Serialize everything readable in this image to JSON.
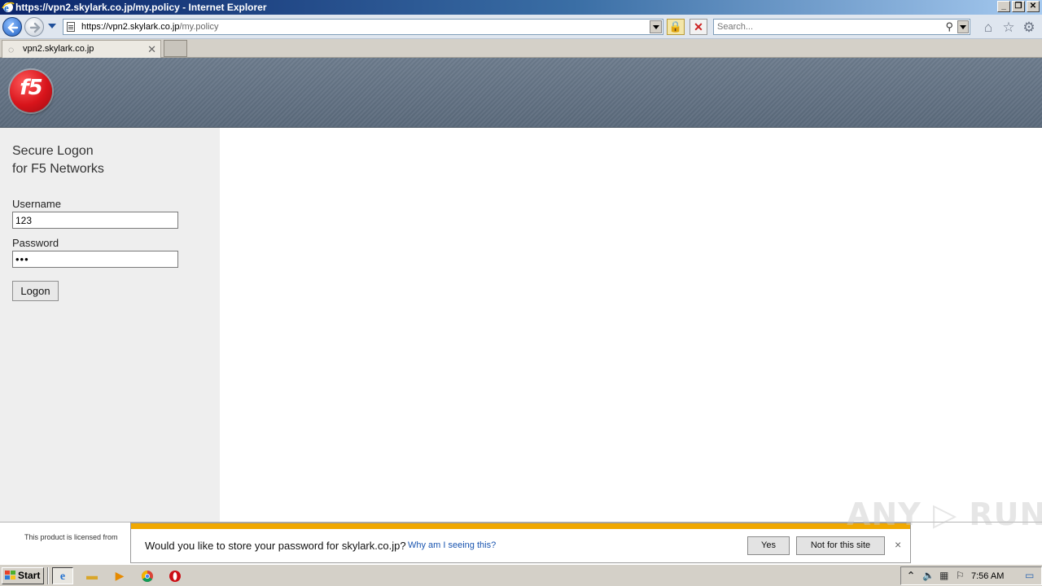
{
  "window": {
    "title": "https://vpn2.skylark.co.jp/my.policy - Internet Explorer"
  },
  "address_bar": {
    "url_host": "https://vpn2.skylark.co.jp",
    "url_path": "/my.policy",
    "search_placeholder": "Search..."
  },
  "tab": {
    "label": "vpn2.skylark.co.jp"
  },
  "header": {
    "logo_text": "f5"
  },
  "login": {
    "title_line1": "Secure Logon",
    "title_line2": "for F5 Networks",
    "username_label": "Username",
    "username_value": "123",
    "password_label": "Password",
    "password_value": "•••",
    "logon_button": "Logon"
  },
  "footer": {
    "license_text": "This product is licensed from"
  },
  "notification": {
    "message": "Would you like to store your password for skylark.co.jp?",
    "why_link": "Why am I seeing this?",
    "yes_button": "Yes",
    "not_button": "Not for this site",
    "close": "×",
    "accent_color": "#f0a800"
  },
  "watermark": {
    "text": "ANY ▷ RUN"
  },
  "taskbar": {
    "start_label": "Start",
    "clock": "7:56 AM"
  }
}
